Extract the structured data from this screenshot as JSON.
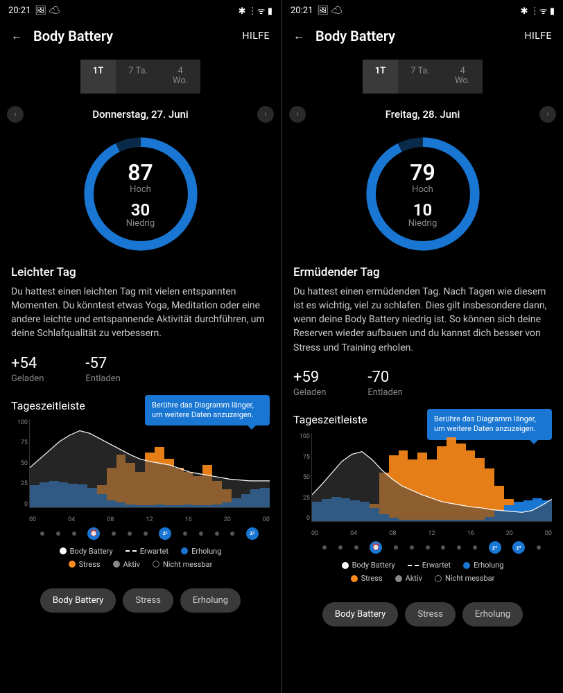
{
  "statusbar": {
    "time": "20:21"
  },
  "header": {
    "title": "Body Battery",
    "help": "HILFE"
  },
  "tabs": {
    "t1": "1T",
    "t7": "7 Ta.",
    "t4w": "4\nWo."
  },
  "timeline_title": "Tageszeitleiste",
  "hint": "Berühre das Diagramm länger, um weitere Daten anzuzeigen.",
  "legend": {
    "bb": "Body Battery",
    "expected": "Erwartet",
    "recovery": "Erholung",
    "stress": "Stress",
    "active": "Aktiv",
    "nm": "Nicht messbar"
  },
  "pills": {
    "bb": "Body Battery",
    "stress": "Stress",
    "recovery": "Erholung"
  },
  "yticks": [
    "100",
    "75",
    "50",
    "25",
    "0"
  ],
  "xticks": [
    "00",
    "04",
    "08",
    "12",
    "16",
    "20",
    "00"
  ],
  "screens": [
    {
      "date": "Donnerstag, 27. Juni",
      "high": "87",
      "high_lbl": "Hoch",
      "low": "30",
      "low_lbl": "Niedrig",
      "desc_title": "Leichter Tag",
      "desc_body": "Du hattest einen leichten Tag mit vielen entspannten Momenten. Du könntest etwas Yoga, Meditation oder eine andere leichte und entspannende Aktivität durchführen, um deine Schlafqualität zu verbessern.",
      "charged": "+54",
      "charged_lbl": "Geladen",
      "drained": "-57",
      "drained_lbl": "Entladen"
    },
    {
      "date": "Freitag, 28. Juni",
      "high": "79",
      "high_lbl": "Hoch",
      "low": "10",
      "low_lbl": "Niedrig",
      "desc_title": "Ermüdender Tag",
      "desc_body": "Du hattest einen ermüdenden Tag. Nach Tagen wie diesem ist es wichtig, viel zu schlafen. Dies gilt insbesondere dann, wenn deine Body Battery niedrig ist. So können sich deine Reserven wieder aufbauen und du kannst dich besser von Stress und Training erholen.",
      "charged": "+59",
      "charged_lbl": "Geladen",
      "drained": "-70",
      "drained_lbl": "Entladen"
    }
  ],
  "chart_data": [
    {
      "type": "area",
      "title": "Tageszeitleiste",
      "ylim": [
        0,
        100
      ],
      "x_hours": [
        0,
        1,
        2,
        3,
        4,
        5,
        6,
        7,
        8,
        9,
        10,
        11,
        12,
        13,
        14,
        15,
        16,
        17,
        18,
        19,
        20,
        21,
        22,
        23,
        24
      ],
      "series": [
        {
          "name": "Body Battery",
          "color": "#ffffff",
          "values": [
            45,
            55,
            65,
            75,
            82,
            87,
            84,
            78,
            72,
            66,
            60,
            55,
            52,
            50,
            48,
            44,
            40,
            38,
            36,
            34,
            32,
            31,
            30,
            30,
            30
          ]
        },
        {
          "name": "Erholung",
          "color": "#1976d2",
          "values": [
            25,
            28,
            30,
            28,
            27,
            26,
            22,
            15,
            8,
            5,
            3,
            2,
            2,
            3,
            2,
            2,
            3,
            2,
            2,
            3,
            5,
            10,
            15,
            20,
            22
          ]
        },
        {
          "name": "Stress",
          "color": "#ff8c1a",
          "values": [
            0,
            0,
            0,
            0,
            0,
            0,
            5,
            25,
            45,
            60,
            50,
            40,
            62,
            68,
            55,
            45,
            40,
            35,
            48,
            30,
            20,
            10,
            5,
            2,
            0
          ]
        }
      ],
      "markers": [
        {
          "type": "alarm",
          "hour": 6
        },
        {
          "type": "sleep",
          "hour": 14
        },
        {
          "type": "sleep",
          "hour": 23.5
        }
      ]
    },
    {
      "type": "area",
      "title": "Tageszeitleiste",
      "ylim": [
        0,
        100
      ],
      "x_hours": [
        0,
        1,
        2,
        3,
        4,
        5,
        6,
        7,
        8,
        9,
        10,
        11,
        12,
        13,
        14,
        15,
        16,
        17,
        18,
        19,
        20,
        21,
        22,
        23,
        24
      ],
      "series": [
        {
          "name": "Body Battery",
          "color": "#ffffff",
          "values": [
            30,
            42,
            55,
            68,
            76,
            79,
            70,
            58,
            48,
            40,
            35,
            30,
            26,
            22,
            20,
            18,
            16,
            15,
            13,
            12,
            11,
            10,
            12,
            18,
            25
          ]
        },
        {
          "name": "Erholung",
          "color": "#1976d2",
          "values": [
            22,
            25,
            28,
            26,
            24,
            22,
            15,
            8,
            4,
            2,
            2,
            2,
            2,
            2,
            2,
            2,
            2,
            2,
            5,
            12,
            18,
            22,
            24,
            26,
            24
          ]
        },
        {
          "name": "Stress",
          "color": "#ff8c1a",
          "values": [
            0,
            0,
            0,
            0,
            0,
            5,
            20,
            55,
            75,
            80,
            70,
            78,
            70,
            85,
            95,
            88,
            80,
            72,
            60,
            40,
            25,
            12,
            5,
            2,
            0
          ]
        }
      ],
      "markers": [
        {
          "type": "alarm",
          "hour": 6
        },
        {
          "type": "run",
          "hour": 7
        },
        {
          "type": "sleep",
          "hour": 20
        },
        {
          "type": "sleep",
          "hour": 22
        }
      ]
    }
  ]
}
